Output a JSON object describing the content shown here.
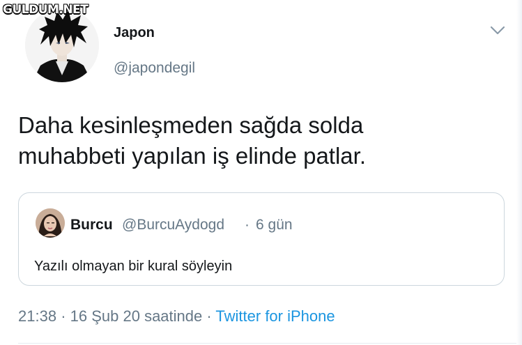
{
  "watermark": {
    "text": "GULDUM.NET"
  },
  "tweet": {
    "author_name": "Japon",
    "author_handle": "@japondegil",
    "text_line1": "Daha kesinleşmeden sağda solda",
    "text_line2": "muhabbeti yapılan iş elinde patlar.",
    "time": "21:38",
    "date": "16 Şub 20 saatinde",
    "source": "Twitter for iPhone",
    "separator": "·"
  },
  "quote": {
    "author_name": "Burcu",
    "author_handle": "@BurcuAydogd",
    "separator": "·",
    "time_ago": "6 gün",
    "text": "Yazılı olmayan bir kural söyleyin"
  },
  "icons": {
    "menu": "chevron-down-icon",
    "author_avatar": "anime-avatar",
    "quote_avatar": "user-avatar"
  }
}
